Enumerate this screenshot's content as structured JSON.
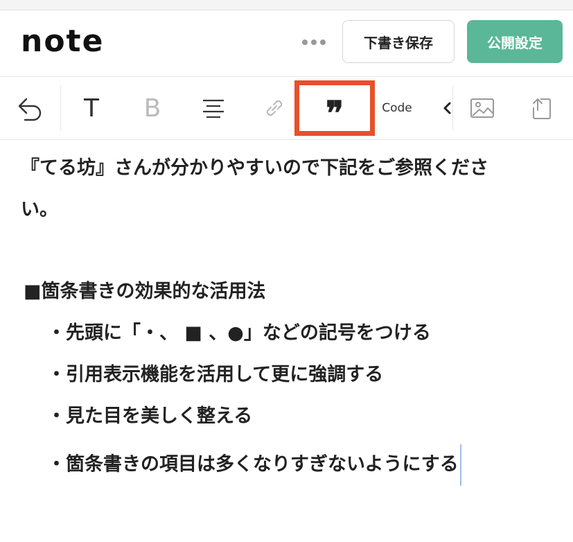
{
  "header": {
    "logo": "note",
    "draft_button": "下書き保存",
    "publish_button": "公開設定"
  },
  "toolbar": {
    "items": [
      {
        "name": "undo",
        "icon": "undo-arrow-icon"
      },
      {
        "name": "text-size",
        "label": "T"
      },
      {
        "name": "bold",
        "label": "B"
      },
      {
        "name": "align",
        "icon": "align-center-icon"
      },
      {
        "name": "link",
        "icon": "link-icon"
      },
      {
        "name": "quote",
        "label": "❞"
      },
      {
        "name": "code",
        "label": "Code"
      },
      {
        "name": "scroll-left",
        "icon": "chevron-left-icon"
      },
      {
        "name": "image",
        "icon": "image-icon"
      },
      {
        "name": "upload",
        "icon": "upload-file-icon"
      }
    ],
    "highlight_color": "#e6502a"
  },
  "content": {
    "line1": "『てる坊』さんが分かりやすいので下記をご参照くださ",
    "line2": "い。",
    "heading": "■箇条書きの効果的な活用法",
    "bullets": [
      "・先頭に「・、 ■ 、●」などの記号をつける",
      "・引用表示機能を活用して更に強調する",
      "・見た目を美しく整える",
      "・箇条書きの項目は多くなりすぎないようにする"
    ]
  },
  "colors": {
    "publish": "#5ab797",
    "highlight": "#e6502a"
  }
}
